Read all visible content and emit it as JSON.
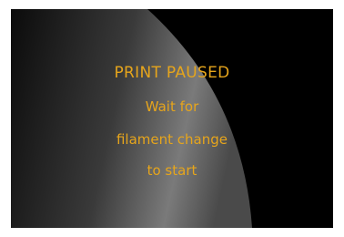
{
  "screen": {
    "title": "PRINT PAUSED",
    "message_lines": [
      "Wait for",
      "filament change",
      "to start"
    ],
    "text_color": "#e6a51c",
    "background_color": "#000000"
  }
}
